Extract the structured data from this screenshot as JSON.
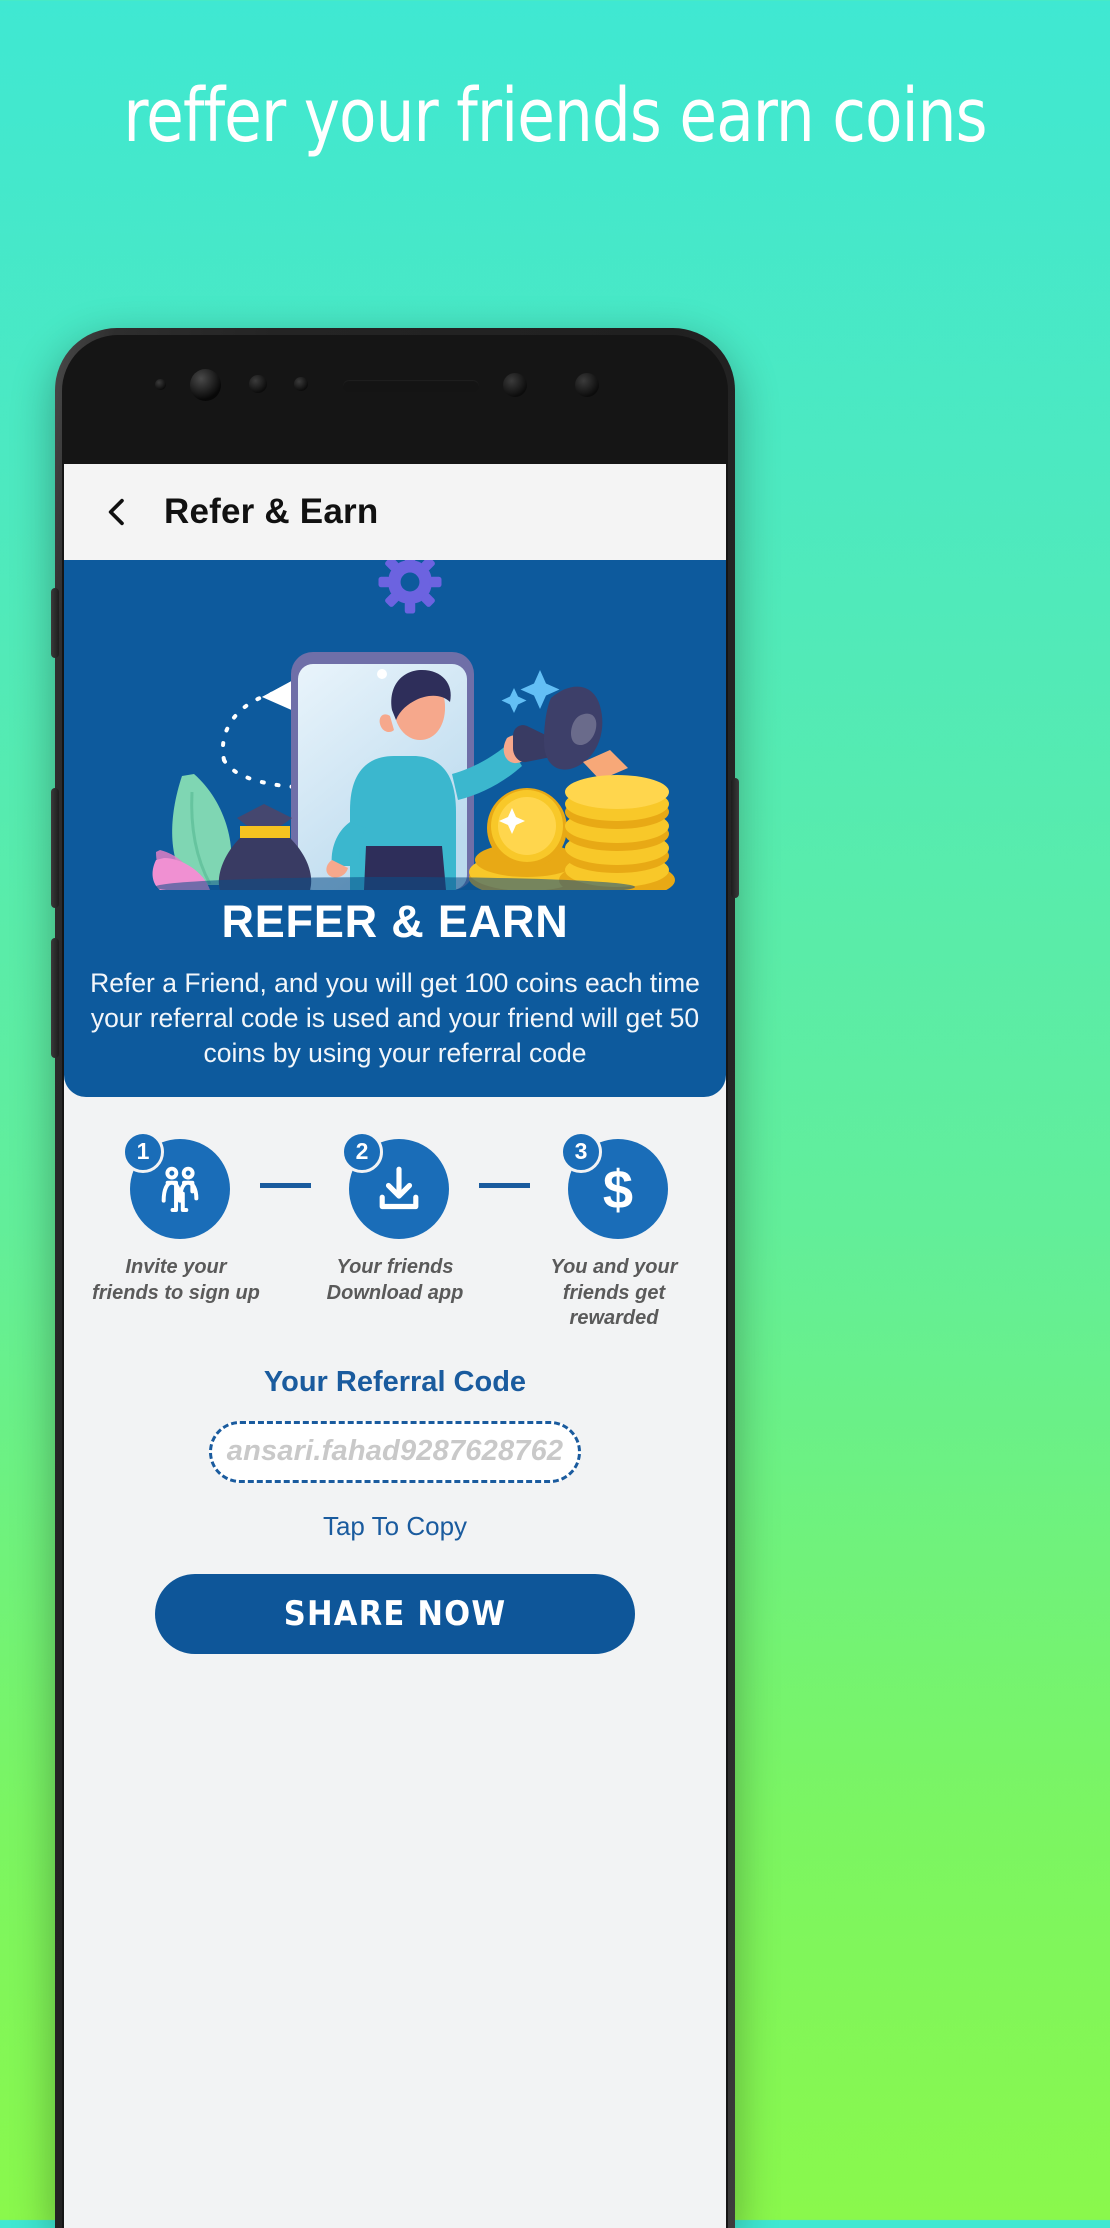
{
  "promo": {
    "headline": "reffer your friends earn coins",
    "background_gradient_from": "#3FE8D2",
    "background_gradient_to": "#8AF84C"
  },
  "appbar": {
    "back_icon": "chevron-left-icon",
    "title": "Refer & Earn",
    "background": "#F4F4F4"
  },
  "hero": {
    "background": "#0D5A9D",
    "illustration_name": "refer-earn-illustration",
    "illustration_elements": [
      "paper-plane-icon",
      "dotted-path",
      "gear-icon",
      "sparkle-icon",
      "smartphone-frame",
      "person-with-megaphone",
      "megaphone-icon",
      "money-bag-icon",
      "leaf-shape",
      "gold-coin-stack"
    ],
    "title": "REFER & EARN",
    "description": "Refer a Friend, and you will get 100 coins each time your referral code is used and your friend will get 50 coins by using your referral code"
  },
  "steps": [
    {
      "number": "1",
      "icon": "two-people-icon",
      "label": "Invite your friends to sign up"
    },
    {
      "number": "2",
      "icon": "download-icon",
      "label": "Your friends Download app"
    },
    {
      "number": "3",
      "icon": "dollar-sign-icon",
      "label": "You and your friends get rewarded"
    }
  ],
  "referral": {
    "title": "Your Referral Code",
    "code": "ansari.fahad9287628762",
    "copy_hint": "Tap To Copy",
    "share_label": "SHARE NOW",
    "accent_color": "#1A5B9E",
    "button_color": "#0E5699"
  }
}
